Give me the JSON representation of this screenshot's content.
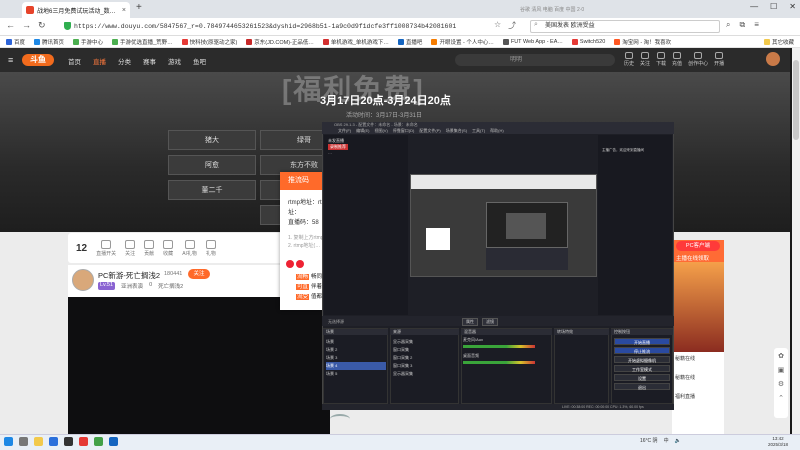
{
  "browser": {
    "tab_title": "战地6三月免费试玩活动_数…",
    "url_main": "https://www.douyu.com/5847567_r=0.7849744653261523&dyshid=2968b51-1a9c0d9f1dcfe3ff1008734b42081601",
    "search_query": "美国发表 欧洲受益",
    "tab_search_hint": "谷歌 清风 电脑 百度 中国 2·0",
    "bookmarks": [
      "百度",
      "腾讯首页",
      "手游中心",
      "手游优选直播_荒野…",
      "快科技(原驱动之家)",
      "京东(JD.COM)-正品低…",
      "单机游戏_单机游戏下…",
      "直播吧",
      "开眼设置 - 个人中心…",
      "FUT Web App - EA…",
      "Switch520",
      "淘宝网 - 淘！我喜欢"
    ],
    "bookmarks_other": "其它收藏"
  },
  "douyu": {
    "logo": "斗鱼",
    "nav": [
      "首页",
      "直播",
      "分类",
      "赛事",
      "游戏",
      "鱼吧"
    ],
    "search_placeholder": "明明",
    "right_items": [
      "历史",
      "关注",
      "下载",
      "充值",
      "创作中心",
      "开播"
    ],
    "banner_title": "[福利免费]",
    "banner_date": "3月17日20点-3月24日20点",
    "banner_sub": "活动时间：3月17日-3月31日",
    "grid_buttons": [
      "猪大",
      "绿哥",
      "阿愈",
      "东方不败",
      "董二千",
      "",
      "",
      ""
    ],
    "player_count": "12",
    "player_bar": [
      "直播开关",
      "关注",
      "贡献",
      "收藏",
      "AI礼物",
      "礼物"
    ],
    "streamer_name": "PC新游-死亡搁浅2",
    "streamer_count": "180441",
    "follow_label": "关注",
    "streamer_tags": [
      "Lv.51",
      "亚洲表演",
      "0",
      "死亡搁浅2"
    ],
    "pc_client": "PC客户端",
    "rp_text": "主播在线领取",
    "rp_list": [
      "秘籍在线",
      "秘籍在线",
      "福利直播"
    ]
  },
  "popup": {
    "head": "推流码",
    "rtmp_label": "rtmp地址：rtmp",
    "addr_label": "址：",
    "code_label": "直播码：58",
    "steps": [
      "1. 复制上方rtmp",
      "2. rtmp地址(…"
    ],
    "rows": [
      {
        "tag": "流畅",
        "text": "畅同"
      },
      {
        "tag": "可直",
        "text": "伴着"
      },
      {
        "tag": "流受",
        "text": "值都"
      }
    ]
  },
  "obs": {
    "title": "OBS 29.1.3 - 配置文件：未命名 - 场景：未命名",
    "menu": [
      "文件(F)",
      "编辑(E)",
      "视图(V)",
      "停靠窗口(D)",
      "配置文件(P)",
      "场景集合(S)",
      "工具(T)",
      "帮助(H)"
    ],
    "left_items": [
      "未发直播",
      "录制推荐",
      "…"
    ],
    "right_text": "主播广告，欢迎来到直播间",
    "ctrl_text": "无选择源",
    "ctrl_btns": [
      "属性",
      "滤镜"
    ],
    "dock_titles": [
      "场景",
      "来源",
      "混音器",
      "转场特效",
      "控制按钮"
    ],
    "scenes": [
      "场景",
      "场景 2",
      "场景 3",
      "场景 4",
      "场景 5"
    ],
    "sources": [
      "显示器采集",
      "窗口采集",
      "窗口采集 2",
      "窗口采集 3",
      "显示器采集",
      "图像",
      "媒体源"
    ],
    "mixer": [
      "麦克风/Aux",
      "桌面音频"
    ],
    "controls": [
      "开始直播",
      "停止推流",
      "开始虚拟摄像机",
      "工作室模式",
      "设置",
      "退出"
    ],
    "status": "LIVE: 00:38:00  REC: 00:00:00  CPU: 1.3%, 60.00 fps"
  },
  "taskbar": {
    "weather": "16°C 阴",
    "lang": "中",
    "time": "13:42",
    "date": "2025/3/18"
  },
  "colors": {
    "accent": "#ff6a2a",
    "brand": "#f26b1d",
    "obs_bg": "#1e1f26"
  }
}
